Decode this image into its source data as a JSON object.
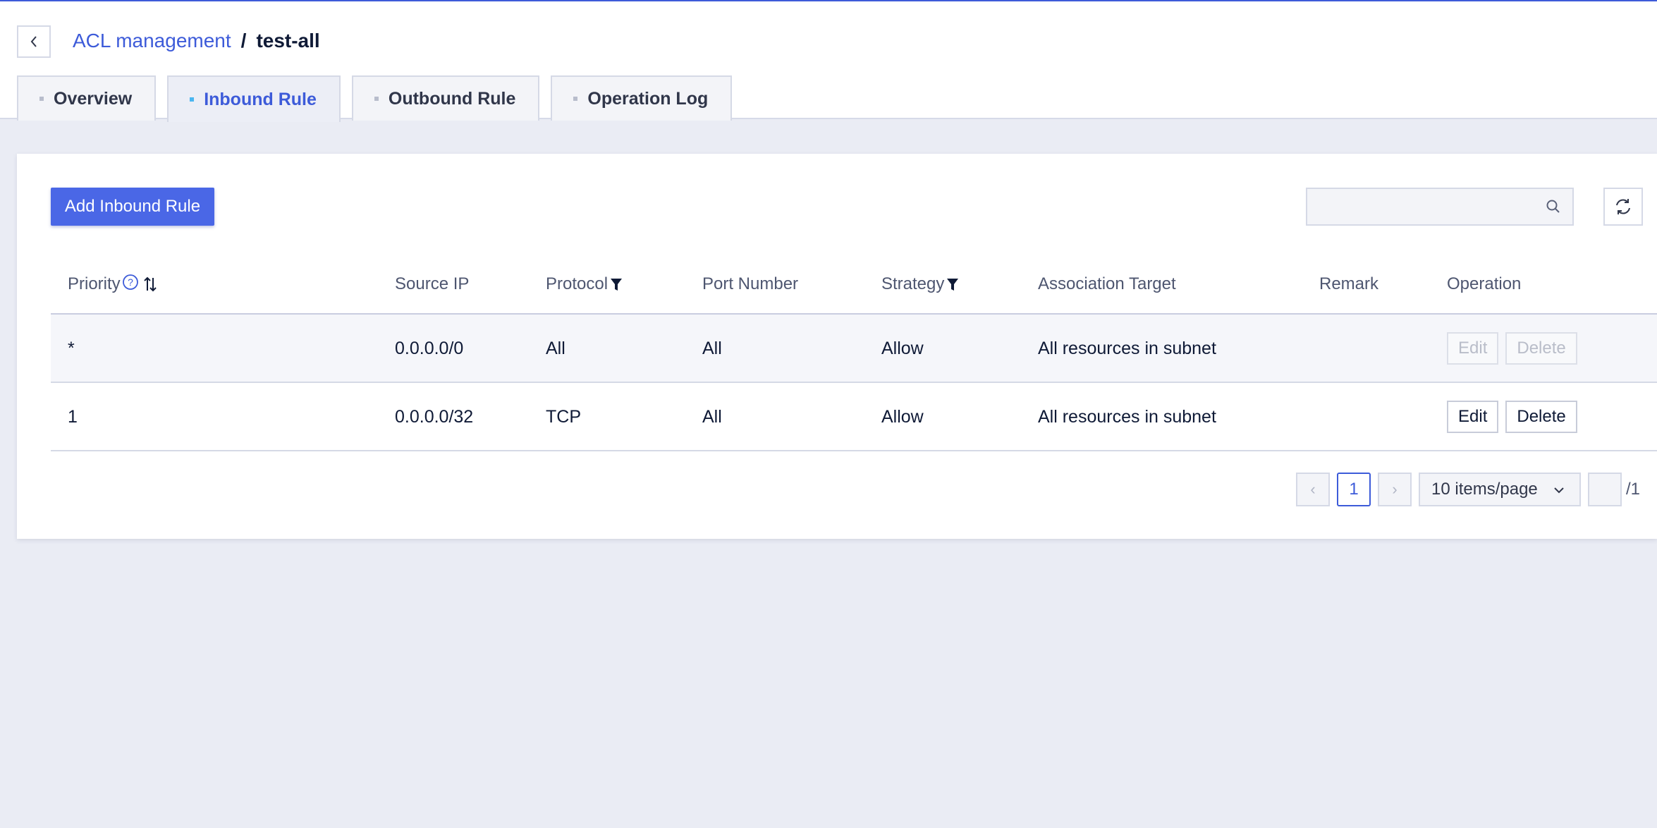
{
  "colors": {
    "accent": "#3d5bd9",
    "button_primary": "#4a67e6",
    "active_dot": "#4bb6f0"
  },
  "breadcrumb": {
    "parent": "ACL management",
    "separator": "/",
    "current": "test-all"
  },
  "tabs": [
    {
      "label": "Overview",
      "active": false
    },
    {
      "label": "Inbound Rule",
      "active": true
    },
    {
      "label": "Outbound Rule",
      "active": false
    },
    {
      "label": "Operation Log",
      "active": false
    }
  ],
  "toolbar": {
    "add_label": "Add Inbound Rule",
    "search_value": "",
    "search_icon": "search-icon",
    "refresh_icon": "refresh-icon"
  },
  "table": {
    "columns": [
      "Priority",
      "Source IP",
      "Protocol",
      "Port Number",
      "Strategy",
      "Association Target",
      "Remark",
      "Operation"
    ],
    "rows": [
      {
        "priority": "*",
        "source_ip": "0.0.0.0/0",
        "protocol": "All",
        "port": "All",
        "strategy": "Allow",
        "target": "All resources in subnet",
        "remark": "",
        "edit": "Edit",
        "delete": "Delete",
        "disabled": true
      },
      {
        "priority": "1",
        "source_ip": "0.0.0.0/32",
        "protocol": "TCP",
        "port": "All",
        "strategy": "Allow",
        "target": "All resources in subnet",
        "remark": "",
        "edit": "Edit",
        "delete": "Delete",
        "disabled": false
      }
    ]
  },
  "pagination": {
    "prev": "‹",
    "page": "1",
    "next": "›",
    "page_size": "10 items/page",
    "jump_value": "",
    "total": "/1"
  }
}
